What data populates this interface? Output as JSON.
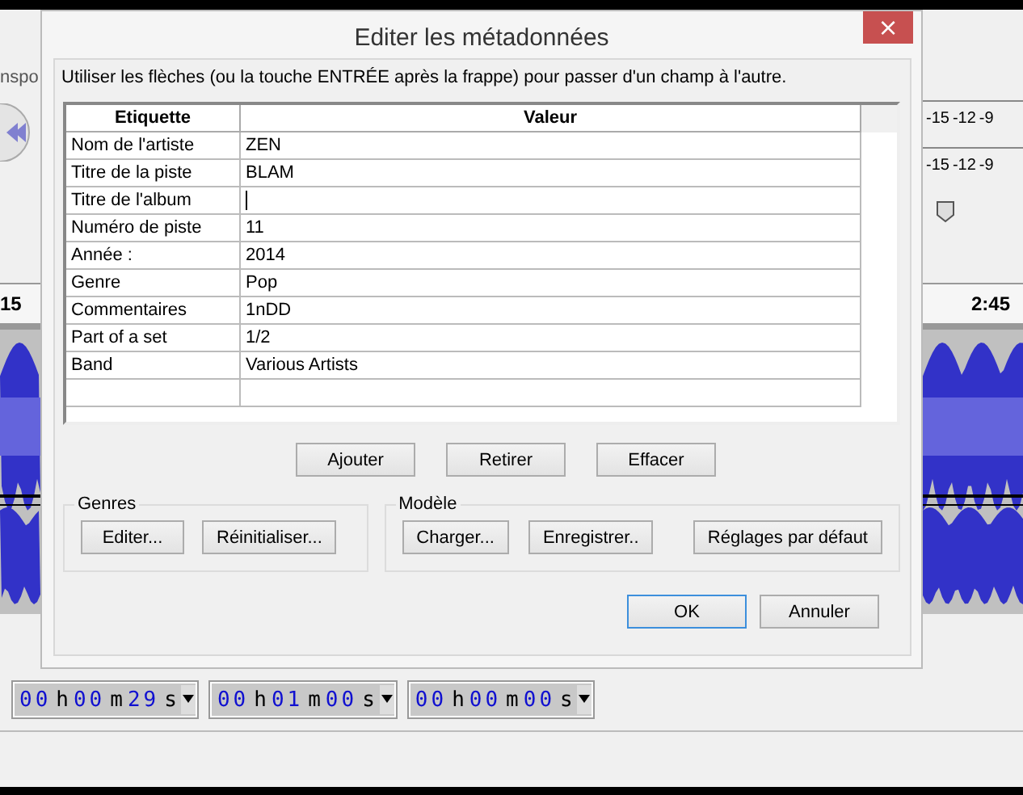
{
  "background_app": {
    "toolbar_label": "nspo",
    "meter_scales": [
      [
        "-15",
        "-12",
        "-9"
      ],
      [
        "-15",
        "-12",
        "-9"
      ]
    ],
    "ruler": {
      "left_tick": "15",
      "right_tick": "2:45"
    },
    "time_fields": [
      [
        {
          "value": "00",
          "unit": "h"
        },
        {
          "value": "00",
          "unit": "m"
        },
        {
          "value": "29",
          "unit": "s"
        }
      ],
      [
        {
          "value": "00",
          "unit": "h"
        },
        {
          "value": "01",
          "unit": "m"
        },
        {
          "value": "00",
          "unit": "s"
        }
      ],
      [
        {
          "value": "00",
          "unit": "h"
        },
        {
          "value": "00",
          "unit": "m"
        },
        {
          "value": "00",
          "unit": "s"
        }
      ]
    ]
  },
  "dialog": {
    "title": "Editer les métadonnées",
    "close": "×",
    "instruction": "Utiliser les flèches (ou la touche ENTRÉE après la frappe) pour passer d'un champ à l'autre.",
    "table": {
      "columns": [
        "Etiquette",
        "Valeur"
      ],
      "rows": [
        {
          "label": "Nom de l'artiste",
          "value": "ZEN",
          "editing": false
        },
        {
          "label": "Titre de la piste",
          "value": "BLAM",
          "editing": false
        },
        {
          "label": "Titre de l'album",
          "editing": true
        },
        {
          "label": "Numéro de piste",
          "value": "11",
          "editing": false
        },
        {
          "label": "Année :",
          "value": "2014",
          "editing": false
        },
        {
          "label": "Genre",
          "value": "Pop",
          "editing": false
        },
        {
          "label": "Commentaires",
          "value": "1nDD",
          "editing": false
        },
        {
          "label": "Part of a set",
          "value": "1/2",
          "editing": false
        },
        {
          "label": "Band",
          "value": "Various Artists",
          "editing": false
        }
      ]
    },
    "row_buttons": [
      "Ajouter",
      "Retirer",
      "Effacer"
    ],
    "groups": [
      {
        "title": "Genres",
        "buttons": [
          "Editer...",
          "Réinitialiser..."
        ]
      },
      {
        "title": "Modèle",
        "buttons": [
          "Charger...",
          "Enregistrer..",
          "Réglages par défaut"
        ]
      }
    ],
    "footer_buttons": [
      {
        "label": "OK",
        "focused": true
      },
      {
        "label": "Annuler",
        "focused": false
      }
    ]
  }
}
